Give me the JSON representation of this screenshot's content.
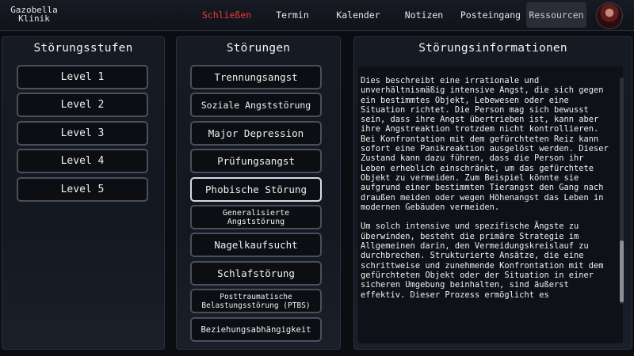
{
  "header": {
    "clinic_name": "Gazobella Klinik",
    "nav": [
      "Schließen",
      "Termin",
      "Kalender",
      "Notizen",
      "Posteingang",
      "Ressourcen"
    ],
    "active_color": "#f03a3a"
  },
  "levels_panel": {
    "title": "Störungsstufen",
    "items": [
      "Level 1",
      "Level 2",
      "Level 3",
      "Level 4",
      "Level 5"
    ]
  },
  "disorders_panel": {
    "title": "Störungen",
    "items": [
      "Trennungsangst",
      "Soziale Angststörung",
      "Major Depression",
      "Prüfungsangst",
      "Phobische Störung",
      "Generalisierte Angststörung",
      "Nagelkaufsucht",
      "Schlafstörung",
      "Posttraumatische Belastungsstörung (PTBS)",
      "Beziehungsabhängigkeit"
    ],
    "selected": "Phobische Störung"
  },
  "info_panel": {
    "title": "Störungsinformationen",
    "paragraphs": [
      "Dies beschreibt eine irrationale und unverhältnismäßig intensive Angst, die sich gegen ein bestimmtes Objekt, Lebewesen oder eine Situation richtet. Die Person mag sich bewusst sein, dass ihre Angst übertrieben ist, kann aber ihre Angstreaktion trotzdem nicht kontrollieren. Bei Konfrontation mit dem gefürchteten Reiz kann sofort eine Panikreaktion ausgelöst werden. Dieser Zustand kann dazu führen, dass die Person ihr Leben erheblich einschränkt, um das gefürchtete Objekt zu vermeiden. Zum Beispiel könnte sie aufgrund einer bestimmten Tierangst den Gang nach draußen meiden oder wegen Höhenangst das Leben in modernen Gebäuden vermeiden.",
      "Um solch intensive und spezifische Ängste zu überwinden, besteht die primäre Strategie im Allgemeinen darin, den Vermeidungskreislauf zu durchbrechen. Strukturierte Ansätze, die eine schrittweise und zunehmende Konfrontation mit dem gefürchteten Objekt oder der Situation in einer sicheren Umgebung beinhalten, sind äußerst effektiv. Dieser Prozess ermöglicht es"
    ]
  }
}
